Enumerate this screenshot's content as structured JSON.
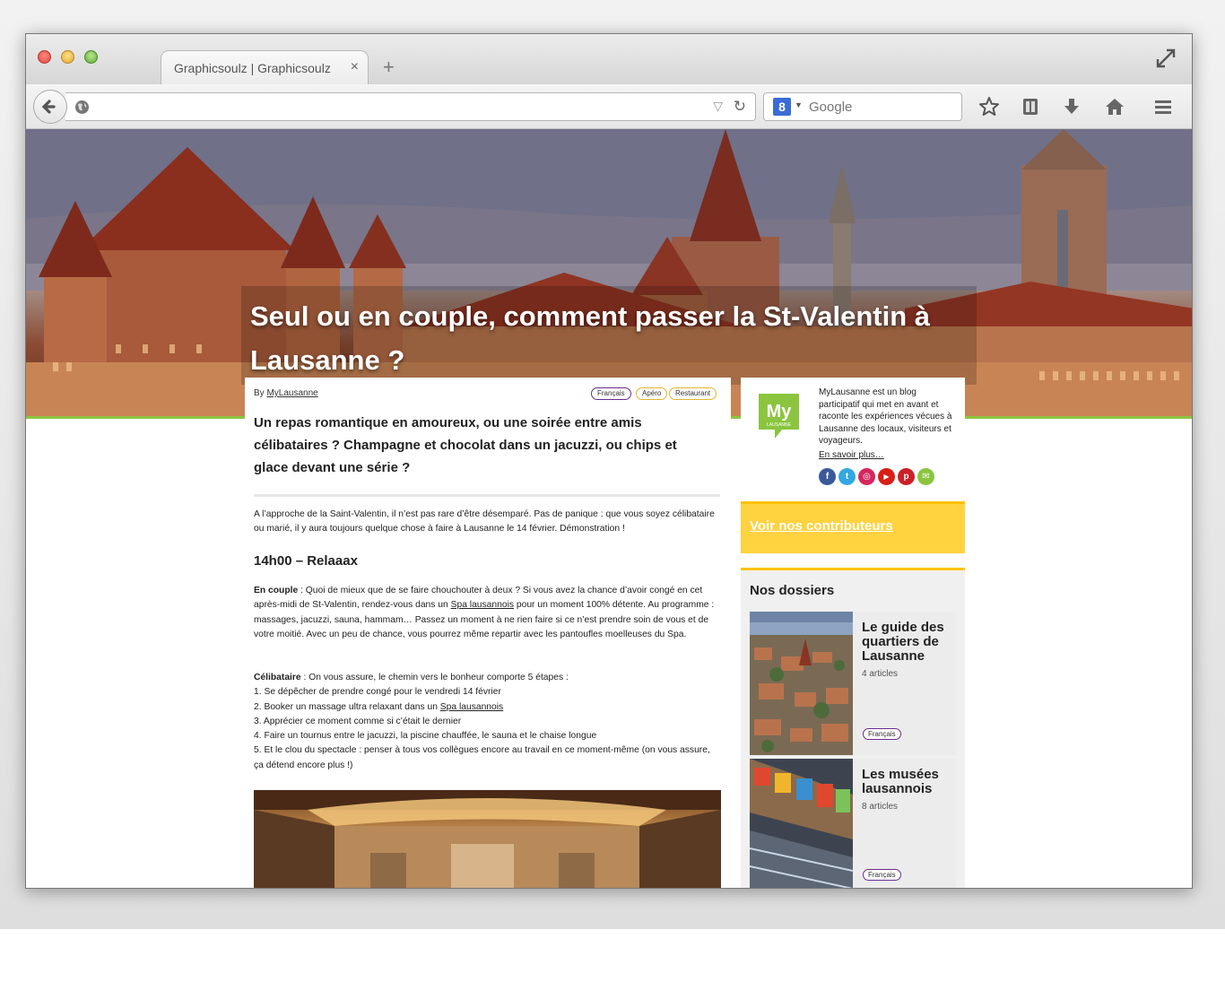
{
  "browser": {
    "tab_title": "Graphicsoulz | Graphicsoulz",
    "tab_close": "×",
    "new_tab": "+",
    "search_placeholder": "Google",
    "search_engine_badge": "8",
    "url_dropdown": "▽",
    "url_reload": "↻",
    "icons": [
      "back-icon",
      "globe-icon",
      "bookmark-star-icon",
      "reading-list-icon",
      "download-icon",
      "home-icon",
      "menu-icon",
      "fullscreen-icon"
    ]
  },
  "hero": {
    "title": "Seul ou en couple, comment passer la St-Valentin à Lausanne ?",
    "accent_color": "#8bc53f"
  },
  "article": {
    "by_prefix": "By ",
    "author": "MyLausanne",
    "tags": [
      "Français",
      "Apéro",
      "Restaurant"
    ],
    "lead": "Un repas romantique en amoureux, ou une soirée entre amis célibataires ? Champagne et chocolat dans un jacuzzi, ou chips et glace devant une série ?",
    "intro": "A l’approche de la Saint-Valentin, il n’est pas rare d’être désemparé. Pas de panique : que vous soyez célibataire ou marié, il y aura toujours quelque chose à faire à Lausanne le 14 février. Démonstration !",
    "heading": "14h00 – Relaaax",
    "couple_label": "En couple",
    "couple_text_1": " : Quoi de mieux que de se faire chouchouter à deux ? Si vous avez la chance d’avoir congé en cet après-midi de St-Valentin, rendez-vous dans un ",
    "couple_link": "Spa lausannois",
    "couple_text_2": " pour un moment 100% détente. Au programme : massages, jacuzzi, sauna, hammam… Passez un moment à ne rien faire si ce n’est prendre soin de vous et de votre moitié. Avec un peu de chance, vous pourrez même repartir avec les pantoufles moelleuses du Spa.",
    "single_label": "Célibataire",
    "single_text": " : On vous assure, le chemin vers le bonheur comporte 5 étapes :",
    "steps": [
      "1. Se dépêcher de prendre congé pour le vendredi 14 février",
      "2. Booker un massage ultra relaxant dans un ",
      "3. Apprécier ce moment comme si c’était le dernier",
      "4. Faire un tournus entre le jacuzzi, la piscine chauffée, le sauna et le chaise longue",
      "5. Et le clou du spectacle : penser à tous vos collègues encore au travail en ce moment-même (on vous assure, ça détend encore plus !)"
    ],
    "step2_link": "Spa lausannois"
  },
  "sidebar": {
    "logo_text": "My",
    "logo_sub": "LAUSANNE",
    "about": "MyLausanne est un blog participatif qui met en avant et raconte les expériences vécues à Lausanne des locaux, visiteurs et voyageurs.",
    "about_more": "En savoir plus…",
    "socials": [
      {
        "icon": "facebook-icon",
        "glyph": "f",
        "color": "#3b5998"
      },
      {
        "icon": "twitter-icon",
        "glyph": "t",
        "color": "#33a8e0"
      },
      {
        "icon": "instagram-icon",
        "glyph": "◎",
        "color": "#d6265d"
      },
      {
        "icon": "youtube-icon",
        "glyph": "▶",
        "color": "#d91e18"
      },
      {
        "icon": "pinterest-icon",
        "glyph": "p",
        "color": "#cb2027"
      },
      {
        "icon": "email-icon",
        "glyph": "✉",
        "color": "#8bc53f"
      }
    ],
    "contributors_link": "Voir nos contributeurs",
    "contributors_color": "#ffd23f",
    "dossiers_title": "Nos dossiers",
    "dossiers": [
      {
        "title": "Le guide des quartiers de Lausanne",
        "count": "4 articles",
        "tag": "Français"
      },
      {
        "title": "Les musées lausannois",
        "count": "8 articles",
        "tag": "Français"
      }
    ]
  }
}
